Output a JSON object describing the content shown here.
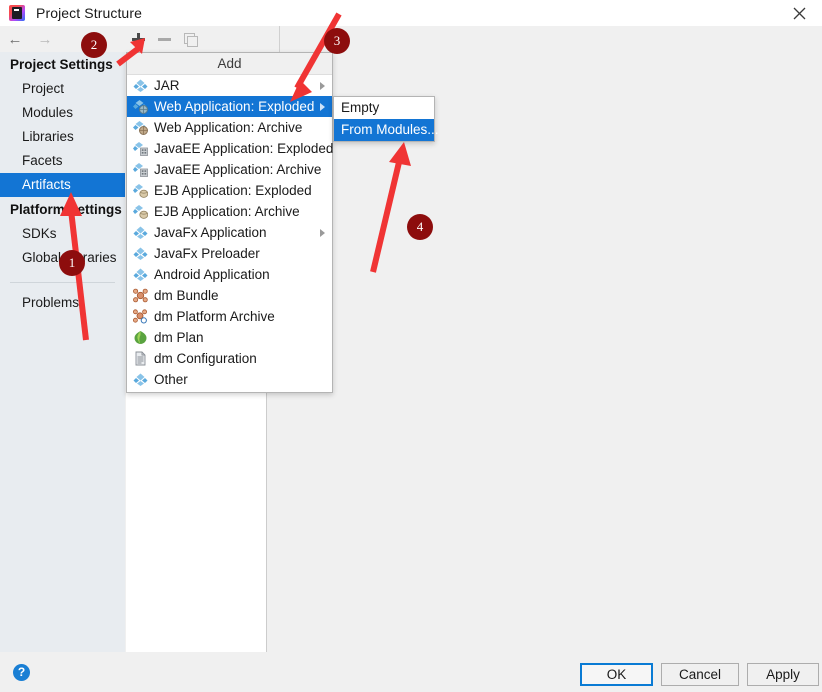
{
  "window": {
    "title": "Project Structure",
    "logo_icon": "intellij-idea-logo-icon",
    "close_icon": "close-icon"
  },
  "nav": {
    "back_icon": "arrow-left-icon",
    "forward_icon": "arrow-right-icon"
  },
  "toolbar": {
    "add_icon": "plus-icon",
    "remove_icon": "minus-icon",
    "copy_icon": "copy-icon"
  },
  "sidebar": {
    "groups": [
      {
        "label": "Project Settings",
        "items": [
          {
            "label": "Project",
            "selected": false
          },
          {
            "label": "Modules",
            "selected": false
          },
          {
            "label": "Libraries",
            "selected": false
          },
          {
            "label": "Facets",
            "selected": false
          },
          {
            "label": "Artifacts",
            "selected": true
          }
        ]
      },
      {
        "label": "Platform Settings",
        "items": [
          {
            "label": "SDKs",
            "selected": false
          },
          {
            "label": "Global Libraries",
            "selected": false
          }
        ]
      }
    ],
    "problems": {
      "label": "Problems",
      "selected": false
    }
  },
  "add_menu": {
    "title": "Add",
    "items": [
      {
        "label": "JAR",
        "icon": "artifact-jar-icon",
        "submenu": true,
        "selected": false
      },
      {
        "label": "Web Application: Exploded",
        "icon": "artifact-web-exploded-icon",
        "submenu": true,
        "selected": true
      },
      {
        "label": "Web Application: Archive",
        "icon": "artifact-web-archive-icon",
        "submenu": false,
        "selected": false
      },
      {
        "label": "JavaEE Application: Exploded",
        "icon": "artifact-javaee-exploded-icon",
        "submenu": false,
        "selected": false
      },
      {
        "label": "JavaEE Application: Archive",
        "icon": "artifact-javaee-archive-icon",
        "submenu": false,
        "selected": false
      },
      {
        "label": "EJB Application: Exploded",
        "icon": "artifact-ejb-exploded-icon",
        "submenu": false,
        "selected": false
      },
      {
        "label": "EJB Application: Archive",
        "icon": "artifact-ejb-archive-icon",
        "submenu": false,
        "selected": false
      },
      {
        "label": "JavaFx Application",
        "icon": "artifact-javafx-icon",
        "submenu": true,
        "selected": false
      },
      {
        "label": "JavaFx Preloader",
        "icon": "artifact-javafx-preloader-icon",
        "submenu": false,
        "selected": false
      },
      {
        "label": "Android Application",
        "icon": "artifact-android-icon",
        "submenu": false,
        "selected": false
      },
      {
        "label": "dm Bundle",
        "icon": "dm-bundle-icon",
        "submenu": false,
        "selected": false
      },
      {
        "label": "dm Platform Archive",
        "icon": "dm-platform-archive-icon",
        "submenu": false,
        "selected": false
      },
      {
        "label": "dm Plan",
        "icon": "dm-plan-icon",
        "submenu": false,
        "selected": false
      },
      {
        "label": "dm Configuration",
        "icon": "dm-configuration-icon",
        "submenu": false,
        "selected": false
      },
      {
        "label": "Other",
        "icon": "artifact-other-icon",
        "submenu": false,
        "selected": false
      }
    ]
  },
  "submenu": {
    "items": [
      {
        "label": "Empty",
        "selected": false
      },
      {
        "label": "From Modules...",
        "selected": true
      }
    ]
  },
  "footer": {
    "help_icon": "help-icon",
    "help_label": "?",
    "ok_label": "OK",
    "cancel_label": "Cancel",
    "apply_label": "Apply"
  },
  "annotations": {
    "badges": [
      {
        "number": "1"
      },
      {
        "number": "2"
      },
      {
        "number": "3"
      },
      {
        "number": "4"
      }
    ],
    "arrow_color": "#f03434",
    "badge_color": "#8d0d0d"
  }
}
